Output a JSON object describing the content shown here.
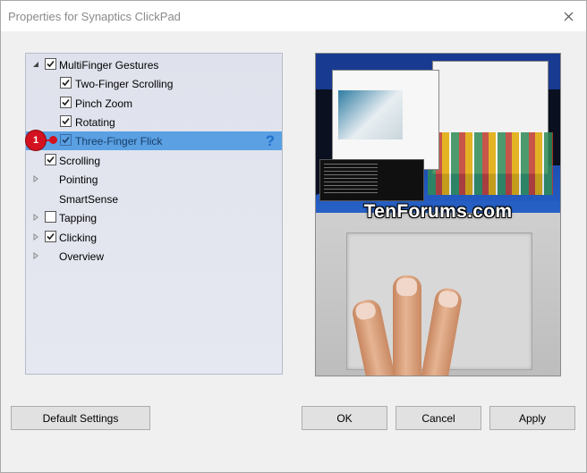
{
  "window": {
    "title": "Properties for Synaptics ClickPad"
  },
  "tree": {
    "items": [
      {
        "label": "MultiFinger Gestures",
        "level": 0,
        "expander": "expanded",
        "checked": true
      },
      {
        "label": "Two-Finger Scrolling",
        "level": 1,
        "expander": "none",
        "checked": true
      },
      {
        "label": "Pinch Zoom",
        "level": 1,
        "expander": "none",
        "checked": true
      },
      {
        "label": "Rotating",
        "level": 1,
        "expander": "none",
        "checked": true
      },
      {
        "label": "Three-Finger Flick",
        "level": 1,
        "expander": "none",
        "checked": true,
        "selected": true
      },
      {
        "label": "Scrolling",
        "level": 0,
        "expander": "none",
        "checked": true
      },
      {
        "label": "Pointing",
        "level": 0,
        "expander": "collapsed",
        "checked": null
      },
      {
        "label": "SmartSense",
        "level": 0,
        "expander": "none",
        "checked": null
      },
      {
        "label": "Tapping",
        "level": 0,
        "expander": "collapsed",
        "checked": false
      },
      {
        "label": "Clicking",
        "level": 0,
        "expander": "collapsed",
        "checked": true
      },
      {
        "label": "Overview",
        "level": 0,
        "expander": "collapsed",
        "checked": null
      }
    ],
    "help_icon": "?",
    "step_marker": "1"
  },
  "preview": {
    "watermark": "TenForums.com"
  },
  "buttons": {
    "default_settings": "Default Settings",
    "ok": "OK",
    "cancel": "Cancel",
    "apply": "Apply"
  },
  "colors": {
    "selection": "#5aa0e3",
    "marker": "#d4121f",
    "help": "#1e6fcc"
  }
}
